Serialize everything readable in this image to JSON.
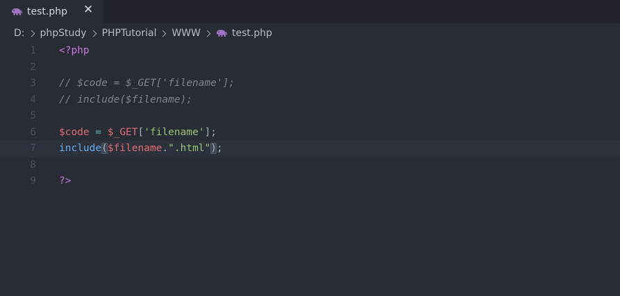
{
  "tab": {
    "label": "test.php",
    "close_symbol": "✕",
    "icon": "php-elephant-icon",
    "icon_color": "#a074c4"
  },
  "breadcrumb": {
    "items": [
      "D:",
      "phpStudy",
      "PHPTutorial",
      "WWW"
    ],
    "file": "test.php"
  },
  "editor": {
    "current_line": 7,
    "lines": [
      {
        "number": "1",
        "tokens": [
          {
            "text": "<?php",
            "type": "kw"
          }
        ]
      },
      {
        "number": "2",
        "tokens": []
      },
      {
        "number": "3",
        "tokens": [
          {
            "text": "// $code = $_GET['filename'];",
            "type": "cm"
          }
        ]
      },
      {
        "number": "4",
        "tokens": [
          {
            "text": "// include($filename);",
            "type": "cm"
          }
        ]
      },
      {
        "number": "5",
        "tokens": []
      },
      {
        "number": "6",
        "tokens": [
          {
            "text": "$code",
            "type": "var"
          },
          {
            "text": " ",
            "type": "pl"
          },
          {
            "text": "=",
            "type": "op"
          },
          {
            "text": " ",
            "type": "pl"
          },
          {
            "text": "$_GET",
            "type": "var"
          },
          {
            "text": "[",
            "type": "br"
          },
          {
            "text": "'filename'",
            "type": "str"
          },
          {
            "text": "];",
            "type": "pl"
          }
        ]
      },
      {
        "number": "7",
        "tokens": [
          {
            "text": "include",
            "type": "fn"
          },
          {
            "text": "(",
            "type": "brm"
          },
          {
            "text": "$filename",
            "type": "var"
          },
          {
            "text": ".",
            "type": "pl"
          },
          {
            "text": "\".html\"",
            "type": "str"
          },
          {
            "text": ")",
            "type": "brm"
          },
          {
            "text": ";",
            "type": "pl"
          }
        ]
      },
      {
        "number": "8",
        "tokens": []
      },
      {
        "number": "9",
        "tokens": [
          {
            "text": "?>",
            "type": "kw"
          }
        ]
      }
    ]
  },
  "colors": {
    "background": "#282c34",
    "tabbar": "#21252b",
    "keyword": "#c678dd",
    "comment": "#7f848e",
    "variable": "#e06c75",
    "string": "#98c379",
    "function": "#61afef",
    "operator": "#56b6c2",
    "cursor": "#528bff"
  }
}
